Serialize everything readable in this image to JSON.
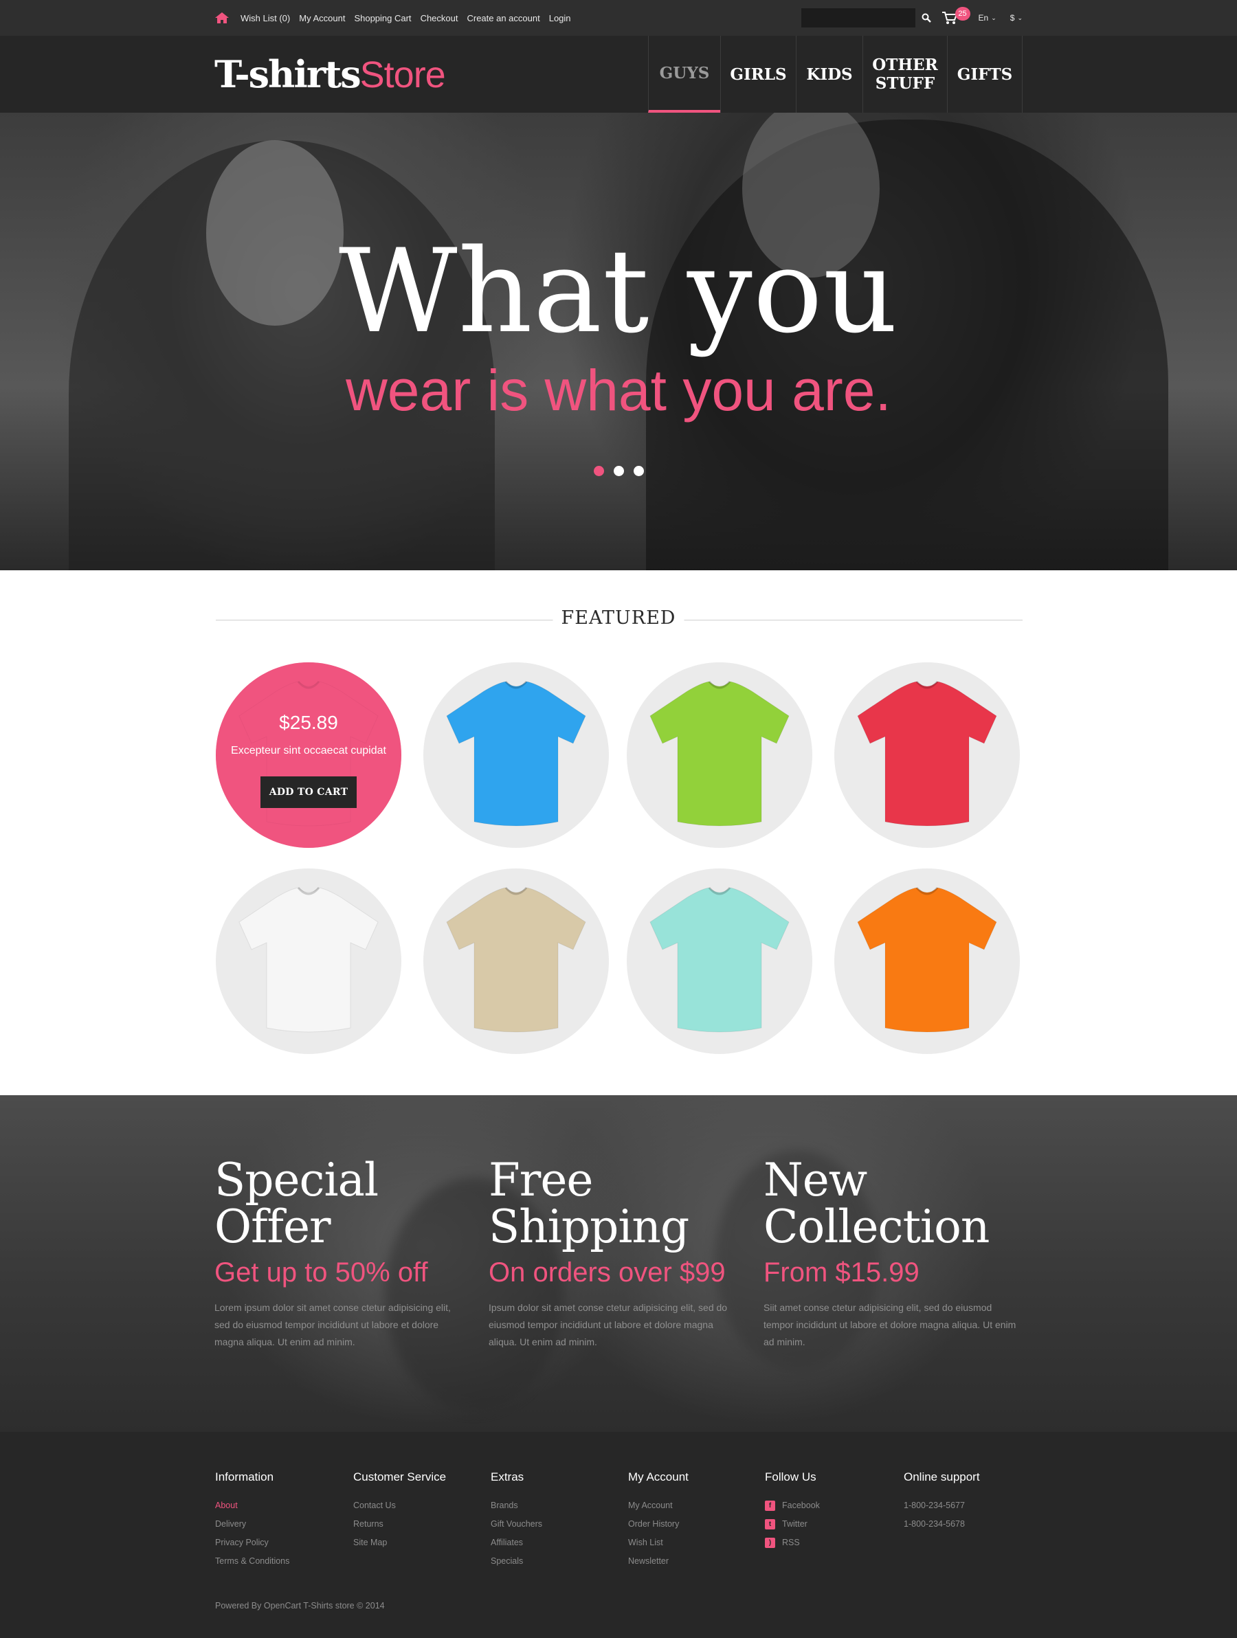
{
  "topbar": {
    "links": [
      "Wish List (0)",
      "My Account",
      "Shopping Cart",
      "Checkout",
      "Create an account",
      "Login"
    ],
    "search_placeholder": "",
    "cart_count": "25",
    "language": "En",
    "currency": "$"
  },
  "header": {
    "logo_bold": "T-shirts",
    "logo_light": "Store",
    "nav": [
      "GUYS",
      "GIRLS",
      "KIDS",
      "OTHER STUFF",
      "GIFTS"
    ],
    "active_nav": "GUYS"
  },
  "hero": {
    "headline": "What you",
    "subline": "wear is what you are.",
    "slide_count": 3,
    "active_slide": 1
  },
  "featured": {
    "title": "FEATURED",
    "hover_card": {
      "price": "$25.89",
      "description": "Excepteur sint occaecat cupidat",
      "button": "ADD TO CART"
    },
    "products": [
      {
        "color": "#f0547f",
        "name": "pink-tshirt"
      },
      {
        "color": "#2fa4ee",
        "name": "blue-tshirt"
      },
      {
        "color": "#92d13a",
        "name": "green-tshirt"
      },
      {
        "color": "#e8364a",
        "name": "red-tshirt"
      },
      {
        "color": "#f6f6f6",
        "name": "white-tshirt"
      },
      {
        "color": "#d8c9a8",
        "name": "beige-tshirt"
      },
      {
        "color": "#98e3d9",
        "name": "mint-tshirt"
      },
      {
        "color": "#f97a12",
        "name": "orange-tshirt"
      }
    ]
  },
  "promo": [
    {
      "title_1": "Special",
      "title_2": "Offer",
      "subtitle": "Get up to 50% off",
      "text": "Lorem ipsum dolor sit amet conse ctetur adipisicing elit, sed do eiusmod tempor incididunt ut labore et dolore magna aliqua. Ut enim ad minim."
    },
    {
      "title_1": "Free",
      "title_2": "Shipping",
      "subtitle": "On orders over $99",
      "text": "Ipsum dolor sit amet conse ctetur adipisicing elit, sed do eiusmod tempor incididunt ut labore et dolore magna aliqua. Ut enim ad minim."
    },
    {
      "title_1": "New",
      "title_2": "Collection",
      "subtitle": "From $15.99",
      "text": "Siit amet conse ctetur adipisicing elit, sed do eiusmod tempor incididunt ut labore et dolore magna aliqua. Ut enim ad minim."
    }
  ],
  "footer": {
    "columns": [
      {
        "heading": "Information",
        "items": [
          "About",
          "Delivery",
          "Privacy Policy",
          "Terms & Conditions"
        ]
      },
      {
        "heading": "Customer Service",
        "items": [
          "Contact Us",
          "Returns",
          "Site Map"
        ]
      },
      {
        "heading": "Extras",
        "items": [
          "Brands",
          "Gift Vouchers",
          "Affiliates",
          "Specials"
        ]
      },
      {
        "heading": "My Account",
        "items": [
          "My Account",
          "Order History",
          "Wish List",
          "Newsletter"
        ]
      },
      {
        "heading": "Follow Us",
        "items": [
          "Facebook",
          "Twitter",
          "RSS"
        ]
      },
      {
        "heading": "Online support",
        "items": [
          "1-800-234-5677",
          "1-800-234-5678"
        ]
      }
    ],
    "social_icons": [
      "facebook-icon",
      "twitter-icon",
      "rss-icon"
    ],
    "powered": "Powered By OpenCart T-Shirts store © 2014"
  },
  "colors": {
    "accent": "#f0547f",
    "dark": "#262626",
    "topbar": "#2f2f2f"
  }
}
